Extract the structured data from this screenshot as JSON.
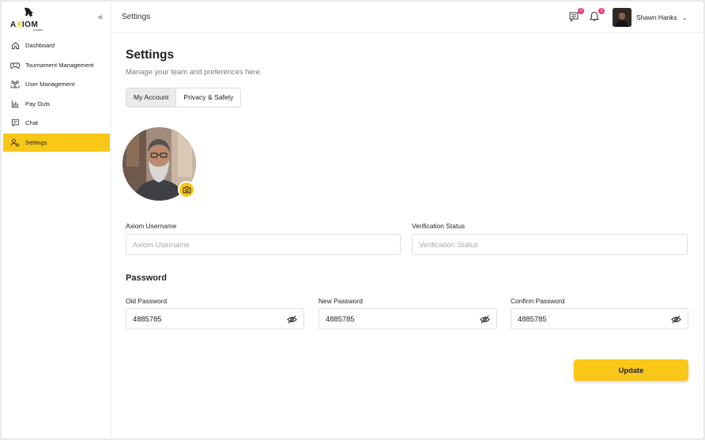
{
  "brand": {
    "logo_text": "AXIOM",
    "logo_sub": "GAMING",
    "accent": "#f8c718"
  },
  "sidebar": {
    "collapse_icon": "double-chevron-left-icon",
    "items": [
      {
        "label": "Dashboard",
        "icon": "home-icon",
        "active": false
      },
      {
        "label": "Tournament Management",
        "icon": "gamepad-icon",
        "active": false
      },
      {
        "label": "User Management",
        "icon": "users-group-icon",
        "active": false
      },
      {
        "label": "Pay Outs",
        "icon": "bar-chart-icon",
        "active": false
      },
      {
        "label": "Chat",
        "icon": "chat-icon",
        "active": false
      },
      {
        "label": "Settings",
        "icon": "user-settings-icon",
        "active": true
      }
    ]
  },
  "header": {
    "title": "Settings",
    "messages_badge": "3",
    "notifications_badge": "3",
    "user_name": "Shawn Hanks"
  },
  "main": {
    "title": "Settings",
    "subtitle": "Manage your team and preferences here.",
    "tabs": [
      {
        "label": "My Account",
        "active": true
      },
      {
        "label": "Privacy & Safety",
        "active": false
      }
    ],
    "username_label": "Axiom Username",
    "username_placeholder": "Axiom Username",
    "verification_label": "Verification Status",
    "verification_placeholder": "Verification Status",
    "password_section": "Password",
    "old_password_label": "Old Password",
    "old_password_value": "4885785",
    "new_password_label": "New Password",
    "new_password_value": "4885785",
    "confirm_password_label": "Confirm Password",
    "confirm_password_value": "4885785",
    "update_label": "Update"
  }
}
